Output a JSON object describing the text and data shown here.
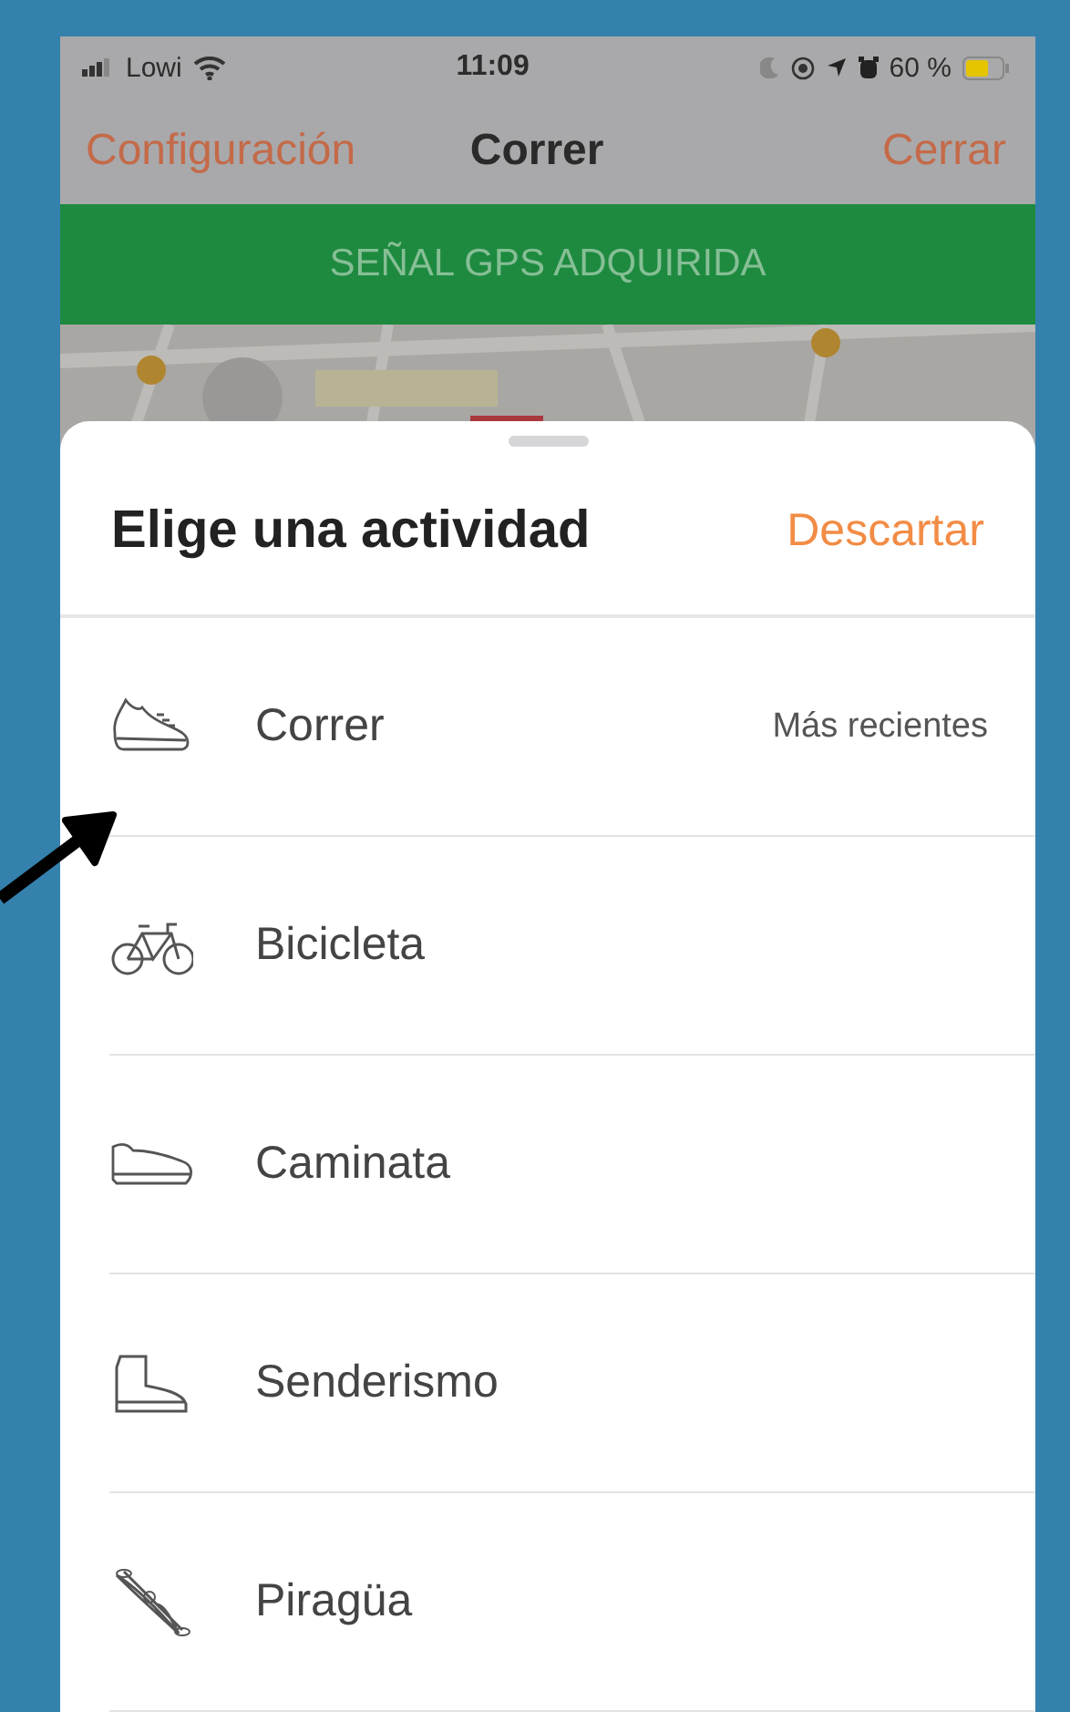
{
  "status_bar": {
    "carrier": "Lowi",
    "time": "11:09",
    "battery": "60 %"
  },
  "nav": {
    "left": "Configuración",
    "title": "Correr",
    "right": "Cerrar"
  },
  "banner": "SEÑAL GPS ADQUIRIDA",
  "sheet": {
    "title": "Elige una actividad",
    "dismiss": "Descartar",
    "activities": [
      {
        "label": "Correr",
        "note": "Más recientes"
      },
      {
        "label": "Bicicleta"
      },
      {
        "label": "Caminata"
      },
      {
        "label": "Senderismo"
      },
      {
        "label": "Piragüa"
      }
    ]
  }
}
